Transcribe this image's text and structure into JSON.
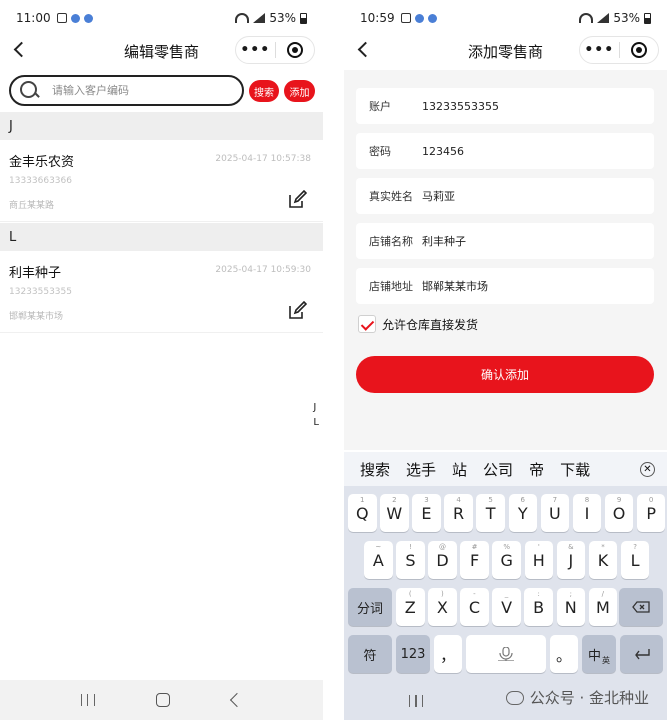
{
  "left": {
    "status": {
      "time": "11:00",
      "battery": "53%"
    },
    "nav": {
      "title": "编辑零售商"
    },
    "search": {
      "placeholder": "请输入客户编码",
      "search_label": "搜索",
      "add_label": "添加"
    },
    "groups": [
      {
        "letter": "J",
        "items": [
          {
            "name": "金丰乐农资",
            "time": "2025-04-17 10:57:38",
            "phone": "13333663366",
            "address": "商丘某某路"
          }
        ]
      },
      {
        "letter": "L",
        "items": [
          {
            "name": "利丰种子",
            "time": "2025-04-17 10:59:30",
            "phone": "13233553355",
            "address": "邯郸某某市场"
          }
        ]
      }
    ],
    "index": [
      "J",
      "L"
    ]
  },
  "right": {
    "status": {
      "time": "10:59",
      "battery": "53%"
    },
    "nav": {
      "title": "添加零售商"
    },
    "fields": [
      {
        "label": "账户",
        "value": "13233553355"
      },
      {
        "label": "密码",
        "value": "123456"
      },
      {
        "label": "真实姓名",
        "value": "马莉亚"
      },
      {
        "label": "店铺名称",
        "value": "利丰种子"
      },
      {
        "label": "店铺地址",
        "value": "邯郸某某市场"
      }
    ],
    "checkbox_label": "允许仓库直接发货",
    "confirm_label": "确认添加",
    "keyboard": {
      "suggestions": [
        "搜索",
        "选手",
        "站",
        "公司",
        "帝",
        "下载"
      ],
      "row1": [
        "Q",
        "W",
        "E",
        "R",
        "T",
        "Y",
        "U",
        "I",
        "O",
        "P"
      ],
      "row1_sup": [
        "1",
        "2",
        "3",
        "4",
        "5",
        "6",
        "7",
        "8",
        "9",
        "0"
      ],
      "row2": [
        "A",
        "S",
        "D",
        "F",
        "G",
        "H",
        "J",
        "K",
        "L"
      ],
      "row2_sup": [
        "~",
        "!",
        "@",
        "#",
        "%",
        "'",
        "&",
        "*",
        "?"
      ],
      "row3": [
        "Z",
        "X",
        "C",
        "V",
        "B",
        "N",
        "M"
      ],
      "row3_sup": [
        "(",
        ")",
        "-",
        "_",
        ":",
        ";",
        "/"
      ],
      "segment_label": "分词",
      "symbol_label": "符",
      "num_label": "123",
      "comma": "，",
      "period": "。",
      "lang_label": "中",
      "lang_sub": "英"
    },
    "watermark": "公众号 · 金北种业"
  }
}
